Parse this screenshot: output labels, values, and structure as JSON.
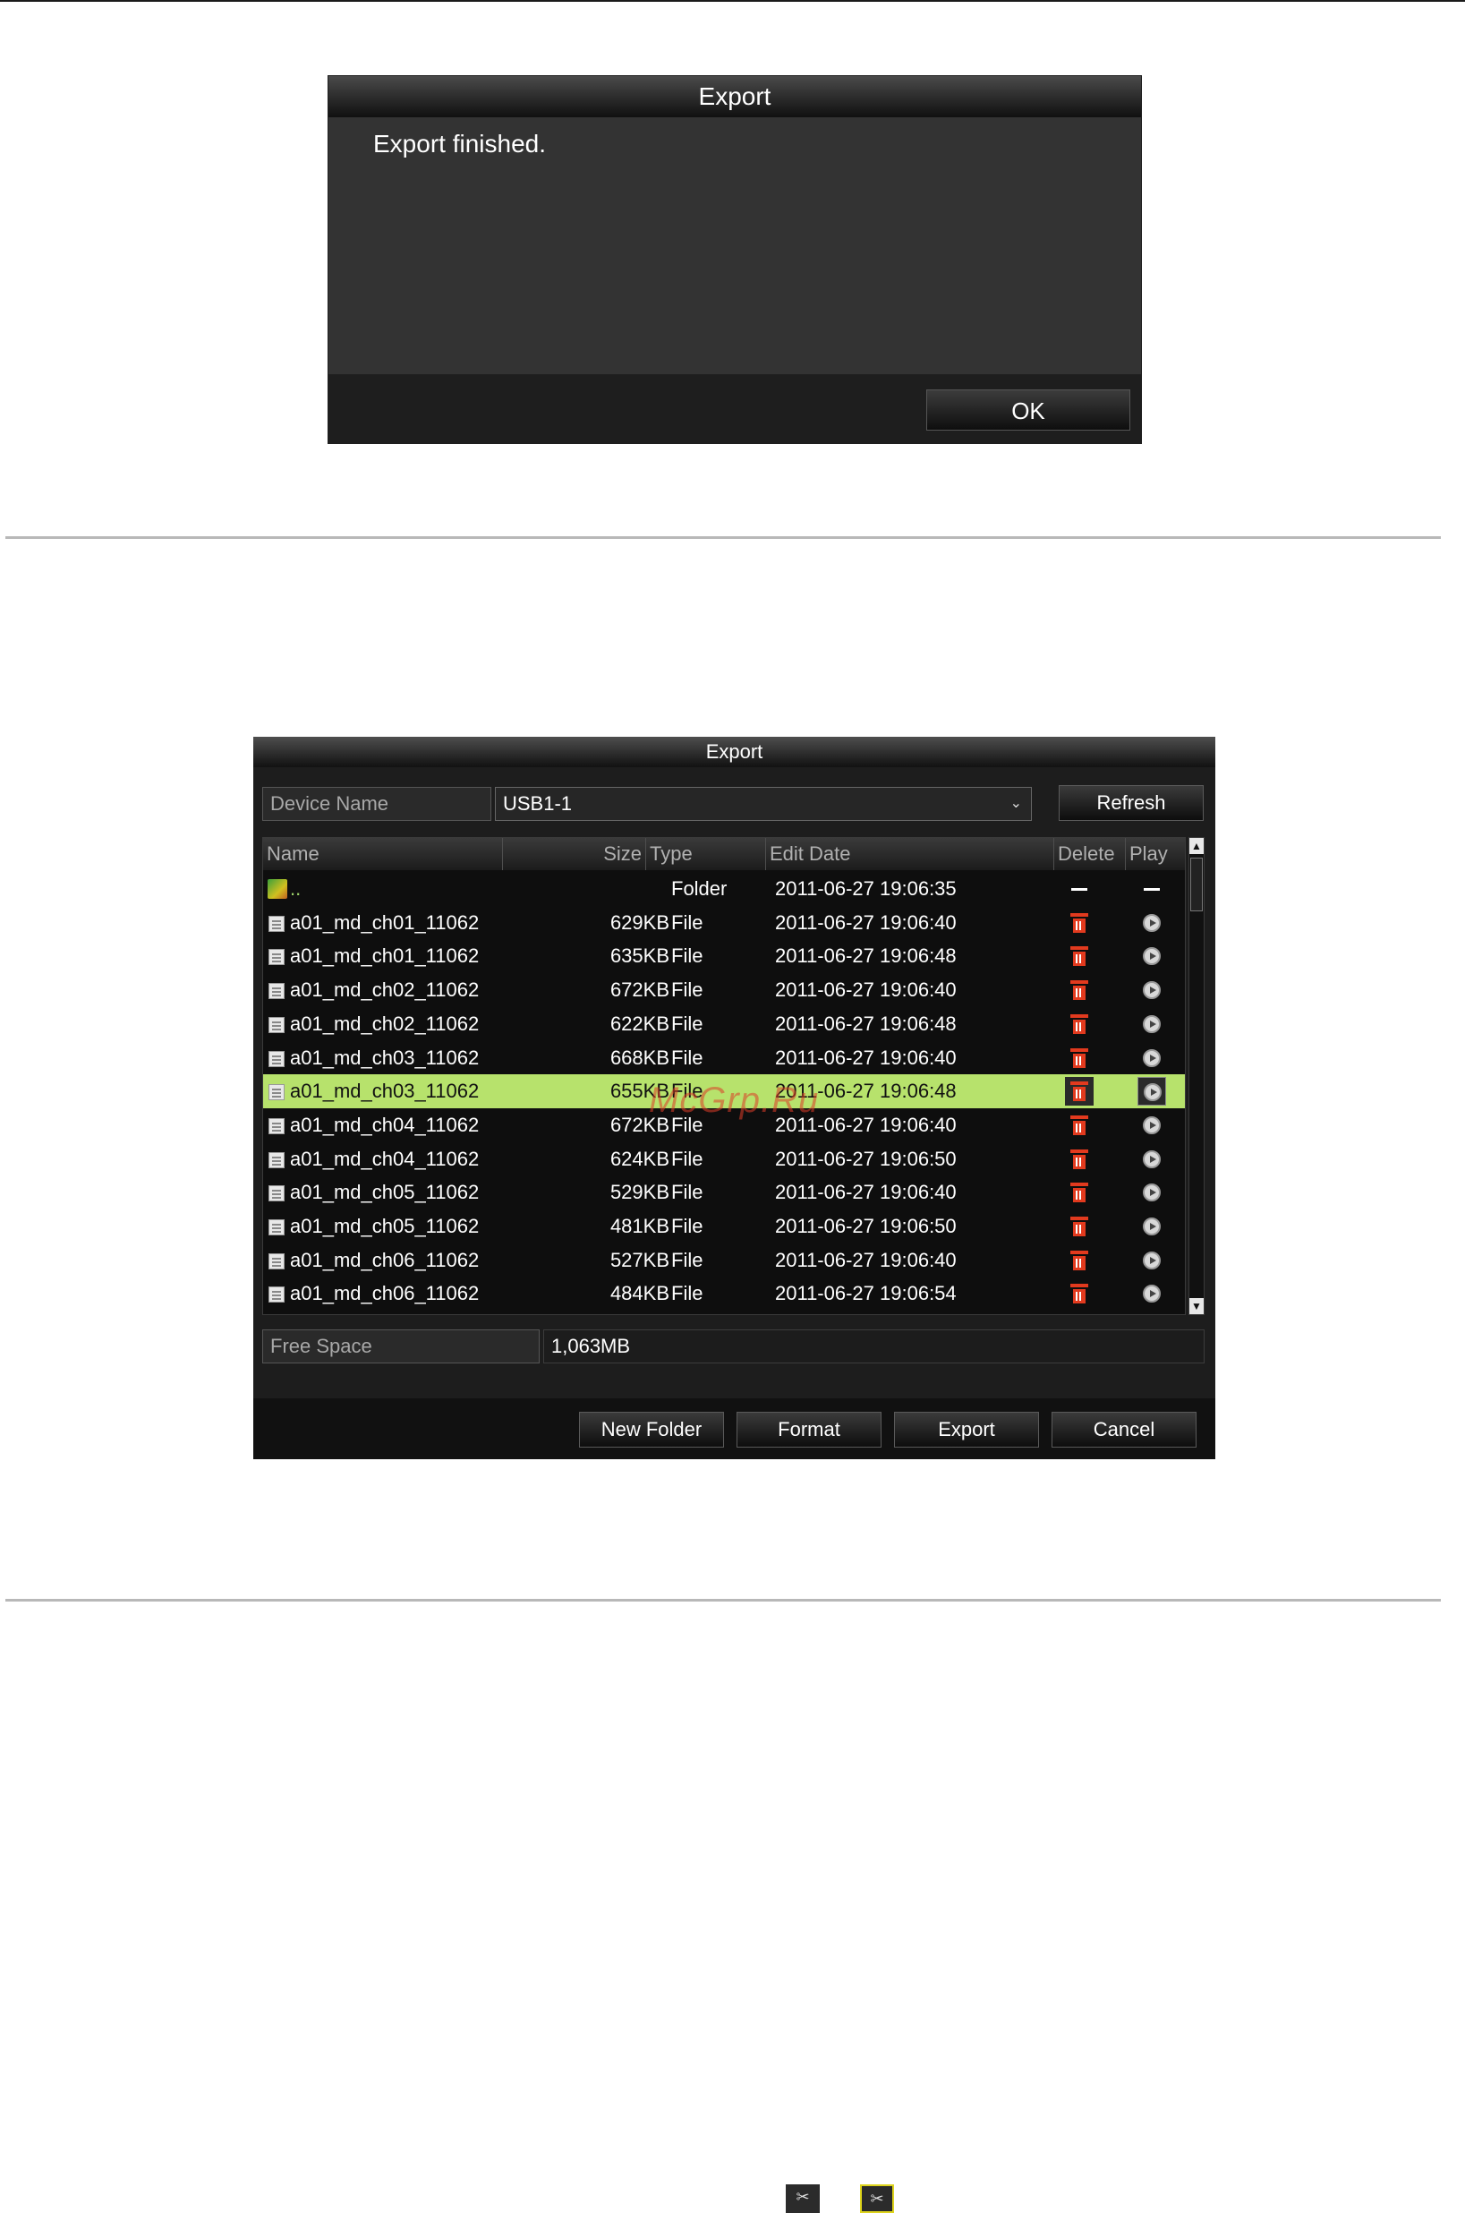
{
  "dialog_finished": {
    "title": "Export",
    "message": "Export finished.",
    "ok_label": "OK"
  },
  "dialog_export": {
    "title": "Export",
    "device_name_label": "Device Name",
    "device_name_value": "USB1-1",
    "refresh_label": "Refresh",
    "columns": {
      "name": "Name",
      "size": "Size",
      "type": "Type",
      "edit_date": "Edit Date",
      "delete": "Delete",
      "play": "Play"
    },
    "rows": [
      {
        "name": "..",
        "size": "",
        "type": "Folder",
        "date": "2011-06-27 19:06:35",
        "kind": "up"
      },
      {
        "name": "a01_md_ch01_11062",
        "size": "629KB",
        "type": "File",
        "date": "2011-06-27 19:06:40",
        "kind": "file"
      },
      {
        "name": "a01_md_ch01_11062",
        "size": "635KB",
        "type": "File",
        "date": "2011-06-27 19:06:48",
        "kind": "file"
      },
      {
        "name": "a01_md_ch02_11062",
        "size": "672KB",
        "type": "File",
        "date": "2011-06-27 19:06:40",
        "kind": "file"
      },
      {
        "name": "a01_md_ch02_11062",
        "size": "622KB",
        "type": "File",
        "date": "2011-06-27 19:06:48",
        "kind": "file"
      },
      {
        "name": "a01_md_ch03_11062",
        "size": "668KB",
        "type": "File",
        "date": "2011-06-27 19:06:40",
        "kind": "file"
      },
      {
        "name": "a01_md_ch03_11062",
        "size": "655KB",
        "type": "File",
        "date": "2011-06-27 19:06:48",
        "kind": "file",
        "selected": true
      },
      {
        "name": "a01_md_ch04_11062",
        "size": "672KB",
        "type": "File",
        "date": "2011-06-27 19:06:40",
        "kind": "file"
      },
      {
        "name": "a01_md_ch04_11062",
        "size": "624KB",
        "type": "File",
        "date": "2011-06-27 19:06:50",
        "kind": "file"
      },
      {
        "name": "a01_md_ch05_11062",
        "size": "529KB",
        "type": "File",
        "date": "2011-06-27 19:06:40",
        "kind": "file"
      },
      {
        "name": "a01_md_ch05_11062",
        "size": "481KB",
        "type": "File",
        "date": "2011-06-27 19:06:50",
        "kind": "file"
      },
      {
        "name": "a01_md_ch06_11062",
        "size": "527KB",
        "type": "File",
        "date": "2011-06-27 19:06:40",
        "kind": "file"
      },
      {
        "name": "a01_md_ch06_11062",
        "size": "484KB",
        "type": "File",
        "date": "2011-06-27 19:06:54",
        "kind": "file"
      }
    ],
    "free_space_label": "Free Space",
    "free_space_value": "1,063MB",
    "buttons": {
      "new_folder": "New Folder",
      "format": "Format",
      "export": "Export",
      "cancel": "Cancel"
    },
    "selected_row_color": "#b7e26c",
    "delete_icon_color": "#e23a1e"
  },
  "watermark": "McGrp.Ru",
  "icons": {
    "scroll_up": "▲",
    "scroll_down": "▼",
    "dropdown": "⌄",
    "tool_icon_1": "clip-icon",
    "tool_icon_2": "clip-confirm-icon"
  }
}
